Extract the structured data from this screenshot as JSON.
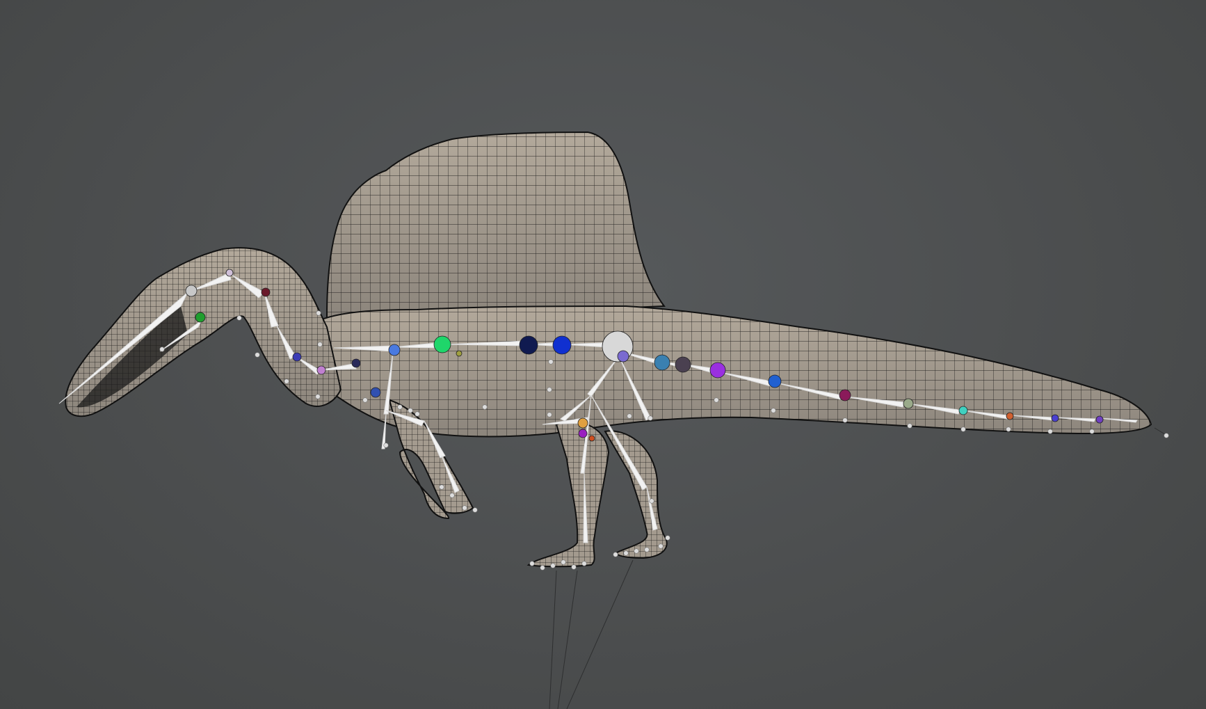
{
  "viewport": {
    "background": "#4c4e4f"
  },
  "model": {
    "mesh_fill": "#a79d8f",
    "mesh_line": "#111111",
    "bone_color": "#f2f2f2",
    "joint_colors": [
      "#c8c8c8",
      "#1f9e2e",
      "#6a1a2a",
      "#d0c0d8",
      "#3c3cb4",
      "#c080d0",
      "#2a2a5a",
      "#4a7ae0",
      "#1fd66a",
      "#a0a040",
      "#101a50",
      "#1030d0",
      "#d8d8d8",
      "#7a6ad0",
      "#3a80b0",
      "#4a4050",
      "#9a30e0",
      "#2060d0",
      "#8a1a5a",
      "#9aaa8a",
      "#40d0c0",
      "#d06030",
      "#4a40d0",
      "#7040c0",
      "#3050b0",
      "#e0a040",
      "#9a20c0",
      "#d05020"
    ]
  }
}
